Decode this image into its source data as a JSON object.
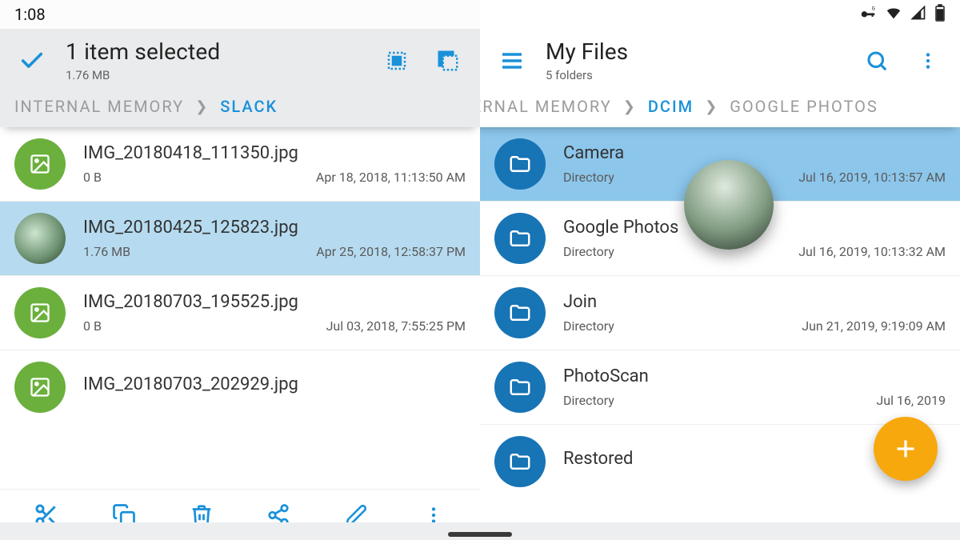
{
  "statusbar": {
    "time": "1:08"
  },
  "left": {
    "title": "1 item selected",
    "subtitle": "1.76 MB",
    "crumbs": [
      "INTERNAL MEMORY",
      "SLACK"
    ],
    "activeCrumb": 1,
    "files": [
      {
        "name": "IMG_20180418_111350.jpg",
        "size": "0 B",
        "date": "Apr 18, 2018, 11:13:50 AM",
        "icon": "image",
        "selected": false
      },
      {
        "name": "IMG_20180425_125823.jpg",
        "size": "1.76 MB",
        "date": "Apr 25, 2018, 12:58:37 PM",
        "icon": "thumb",
        "selected": true
      },
      {
        "name": "IMG_20180703_195525.jpg",
        "size": "0 B",
        "date": "Jul 03, 2018, 7:55:25 PM",
        "icon": "image",
        "selected": false
      },
      {
        "name": "IMG_20180703_202929.jpg",
        "size": "",
        "date": "",
        "icon": "image",
        "selected": false
      }
    ]
  },
  "right": {
    "title": "My Files",
    "subtitle": "5 folders",
    "crumbs": [
      "NTERNAL MEMORY",
      "DCIM",
      "GOOGLE PHOTOS"
    ],
    "activeCrumb": 1,
    "folders": [
      {
        "name": "Camera",
        "type": "Directory",
        "date": "Jul 16, 2019, 10:13:57 AM",
        "highlight": true
      },
      {
        "name": "Google Photos",
        "type": "Directory",
        "date": "Jul 16, 2019, 10:13:32 AM",
        "highlight": false
      },
      {
        "name": "Join",
        "type": "Directory",
        "date": "Jun 21, 2019, 9:19:09 AM",
        "highlight": false
      },
      {
        "name": "PhotoScan",
        "type": "Directory",
        "date": "Jul 16, 2019",
        "highlight": false
      },
      {
        "name": "Restored",
        "type": "",
        "date": "",
        "highlight": false
      }
    ]
  },
  "colors": {
    "accent": "#1a91d9",
    "green": "#6bb03d",
    "blue": "#1774b5",
    "fab": "#f7a80d"
  }
}
